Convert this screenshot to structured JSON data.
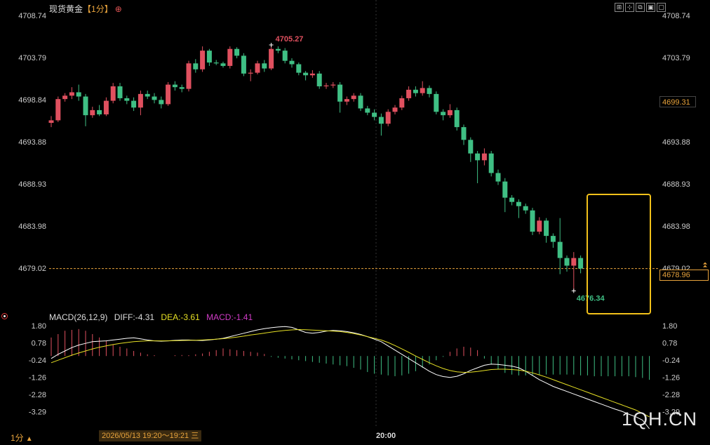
{
  "header": {
    "name": "现货黄金",
    "period_tag": "【1分】",
    "add_icon": "⊕"
  },
  "toolbar": {
    "icons": [
      "fullscreen-icon",
      "crosshair-icon",
      "settings-icon",
      "expand-icon",
      "minimize-icon"
    ],
    "glyphs": [
      "⊞",
      "⊹",
      "⧉",
      "▣",
      "▢"
    ]
  },
  "price_axis": {
    "ticks": [
      4708.74,
      4703.79,
      4698.84,
      4693.88,
      4688.93,
      4683.98,
      4679.02
    ],
    "tick_labels": [
      "4708.74",
      "4703.79",
      "4698.84",
      "4693.88",
      "4688.93",
      "4683.98",
      "4679.02"
    ],
    "current_marker": "4699.31",
    "last_price": "4678.96"
  },
  "macd_axis": {
    "ticks": [
      1.8,
      0.78,
      -0.24,
      -1.26,
      -2.28,
      -3.29
    ],
    "tick_labels": [
      "1.80",
      "0.78",
      "-0.24",
      "-1.26",
      "-2.28",
      "-3.29"
    ]
  },
  "macd_legend": {
    "params": "MACD(26,12,9)",
    "diff": "DIFF:-4.31",
    "dea": "DEA:-3.61",
    "macd": "MACD:-1.41"
  },
  "footer": {
    "period": "1分",
    "period_arrow": "▲",
    "range": "2026/05/13 19:20～19:21 三",
    "time_label": "20:00"
  },
  "watermark": "1QH.CN",
  "colors": {
    "up": "#e0505f",
    "down": "#3fbf84",
    "dea": "#e6e024",
    "diff": "#ffffff",
    "accent": "#e8a33c",
    "highlight_box": "#f2c11a"
  },
  "chart_data": [
    {
      "type": "candlestick",
      "title": "现货黄金【1分】",
      "ylim": [
        4676.0,
        4710.0
      ],
      "high_annotation": "4705.27",
      "low_annotation": "4676.34",
      "candles": [
        {
          "o": 4696.1,
          "c": 4696.4,
          "h": 4696.9,
          "l": 4695.6
        },
        {
          "o": 4696.4,
          "c": 4698.9,
          "h": 4699.2,
          "l": 4696.2
        },
        {
          "o": 4698.9,
          "c": 4699.3,
          "h": 4699.6,
          "l": 4698.6
        },
        {
          "o": 4699.3,
          "c": 4699.7,
          "h": 4700.3,
          "l": 4698.9
        },
        {
          "o": 4699.7,
          "c": 4699.2,
          "h": 4700.6,
          "l": 4698.7
        },
        {
          "o": 4699.2,
          "c": 4697.0,
          "h": 4699.5,
          "l": 4695.7
        },
        {
          "o": 4697.0,
          "c": 4697.6,
          "h": 4698.0,
          "l": 4696.7
        },
        {
          "o": 4697.6,
          "c": 4697.1,
          "h": 4698.2,
          "l": 4696.9
        },
        {
          "o": 4697.1,
          "c": 4698.7,
          "h": 4699.1,
          "l": 4696.9
        },
        {
          "o": 4698.7,
          "c": 4700.4,
          "h": 4700.8,
          "l": 4698.4
        },
        {
          "o": 4700.4,
          "c": 4699.0,
          "h": 4700.8,
          "l": 4698.7
        },
        {
          "o": 4699.0,
          "c": 4698.7,
          "h": 4699.3,
          "l": 4698.3
        },
        {
          "o": 4698.7,
          "c": 4697.9,
          "h": 4699.1,
          "l": 4697.5
        },
        {
          "o": 4697.9,
          "c": 4699.5,
          "h": 4699.9,
          "l": 4697.0
        },
        {
          "o": 4699.5,
          "c": 4699.2,
          "h": 4699.9,
          "l": 4698.9
        },
        {
          "o": 4699.2,
          "c": 4698.8,
          "h": 4699.6,
          "l": 4698.4
        },
        {
          "o": 4698.8,
          "c": 4698.3,
          "h": 4699.2,
          "l": 4697.8
        },
        {
          "o": 4698.3,
          "c": 4700.6,
          "h": 4700.9,
          "l": 4698.1
        },
        {
          "o": 4700.6,
          "c": 4700.3,
          "h": 4701.0,
          "l": 4699.9
        },
        {
          "o": 4700.3,
          "c": 4700.1,
          "h": 4700.6,
          "l": 4699.7
        },
        {
          "o": 4700.1,
          "c": 4703.1,
          "h": 4703.4,
          "l": 4699.8
        },
        {
          "o": 4703.1,
          "c": 4702.4,
          "h": 4703.6,
          "l": 4702.0
        },
        {
          "o": 4702.4,
          "c": 4704.6,
          "h": 4705.1,
          "l": 4702.1
        },
        {
          "o": 4704.6,
          "c": 4703.2,
          "h": 4704.8,
          "l": 4702.8
        },
        {
          "o": 4703.2,
          "c": 4703.1,
          "h": 4703.5,
          "l": 4702.9
        },
        {
          "o": 4703.1,
          "c": 4702.8,
          "h": 4703.3,
          "l": 4702.6
        },
        {
          "o": 4702.8,
          "c": 4704.8,
          "h": 4705.1,
          "l": 4702.5
        },
        {
          "o": 4704.8,
          "c": 4704.0,
          "h": 4705.0,
          "l": 4703.7
        },
        {
          "o": 4704.0,
          "c": 4701.9,
          "h": 4704.3,
          "l": 4701.6
        },
        {
          "o": 4701.9,
          "c": 4702.0,
          "h": 4702.4,
          "l": 4701.0
        },
        {
          "o": 4702.0,
          "c": 4703.1,
          "h": 4703.4,
          "l": 4701.8
        },
        {
          "o": 4703.1,
          "c": 4702.5,
          "h": 4703.5,
          "l": 4702.1
        },
        {
          "o": 4702.5,
          "c": 4704.8,
          "h": 4705.27,
          "l": 4702.3
        },
        {
          "o": 4704.8,
          "c": 4704.6,
          "h": 4705.1,
          "l": 4704.3
        },
        {
          "o": 4704.6,
          "c": 4703.4,
          "h": 4704.9,
          "l": 4703.1
        },
        {
          "o": 4703.4,
          "c": 4703.0,
          "h": 4703.7,
          "l": 4702.6
        },
        {
          "o": 4703.0,
          "c": 4702.0,
          "h": 4703.2,
          "l": 4701.7
        },
        {
          "o": 4702.0,
          "c": 4701.7,
          "h": 4702.2,
          "l": 4701.1
        },
        {
          "o": 4701.7,
          "c": 4701.9,
          "h": 4702.3,
          "l": 4701.4
        },
        {
          "o": 4701.9,
          "c": 4700.4,
          "h": 4702.2,
          "l": 4700.1
        },
        {
          "o": 4700.4,
          "c": 4700.5,
          "h": 4700.8,
          "l": 4700.1
        },
        {
          "o": 4700.5,
          "c": 4700.6,
          "h": 4700.9,
          "l": 4700.2
        },
        {
          "o": 4700.6,
          "c": 4698.6,
          "h": 4700.9,
          "l": 4697.3
        },
        {
          "o": 4698.6,
          "c": 4698.9,
          "h": 4699.2,
          "l": 4698.2
        },
        {
          "o": 4698.9,
          "c": 4699.3,
          "h": 4699.6,
          "l": 4698.6
        },
        {
          "o": 4699.3,
          "c": 4697.8,
          "h": 4699.6,
          "l": 4697.5
        },
        {
          "o": 4697.8,
          "c": 4697.3,
          "h": 4698.1,
          "l": 4697.0
        },
        {
          "o": 4697.3,
          "c": 4696.8,
          "h": 4697.7,
          "l": 4696.4
        },
        {
          "o": 4696.8,
          "c": 4696.0,
          "h": 4697.2,
          "l": 4694.6
        },
        {
          "o": 4696.0,
          "c": 4697.4,
          "h": 4697.7,
          "l": 4695.7
        },
        {
          "o": 4697.4,
          "c": 4697.9,
          "h": 4698.2,
          "l": 4697.1
        },
        {
          "o": 4697.9,
          "c": 4699.0,
          "h": 4699.3,
          "l": 4697.6
        },
        {
          "o": 4699.0,
          "c": 4700.0,
          "h": 4700.4,
          "l": 4698.7
        },
        {
          "o": 4700.0,
          "c": 4699.6,
          "h": 4700.4,
          "l": 4699.2
        },
        {
          "o": 4699.6,
          "c": 4700.2,
          "h": 4701.0,
          "l": 4699.3
        },
        {
          "o": 4700.2,
          "c": 4699.5,
          "h": 4700.5,
          "l": 4699.1
        },
        {
          "o": 4699.5,
          "c": 4697.4,
          "h": 4699.8,
          "l": 4697.1
        },
        {
          "o": 4697.4,
          "c": 4697.0,
          "h": 4697.7,
          "l": 4696.4
        },
        {
          "o": 4697.0,
          "c": 4697.6,
          "h": 4698.3,
          "l": 4696.7
        },
        {
          "o": 4697.6,
          "c": 4695.6,
          "h": 4697.9,
          "l": 4695.2
        },
        {
          "o": 4695.6,
          "c": 4694.1,
          "h": 4695.9,
          "l": 4693.5
        },
        {
          "o": 4694.1,
          "c": 4692.5,
          "h": 4694.4,
          "l": 4691.5
        },
        {
          "o": 4692.5,
          "c": 4691.7,
          "h": 4692.8,
          "l": 4689.0
        },
        {
          "o": 4691.7,
          "c": 4692.5,
          "h": 4693.1,
          "l": 4691.1
        },
        {
          "o": 4692.5,
          "c": 4690.2,
          "h": 4692.8,
          "l": 4689.8
        },
        {
          "o": 4690.2,
          "c": 4689.2,
          "h": 4690.6,
          "l": 4688.8
        },
        {
          "o": 4689.2,
          "c": 4687.3,
          "h": 4689.6,
          "l": 4685.6
        },
        {
          "o": 4687.3,
          "c": 4686.8,
          "h": 4687.6,
          "l": 4686.4
        },
        {
          "o": 4686.8,
          "c": 4686.3,
          "h": 4687.1,
          "l": 4684.9
        },
        {
          "o": 4686.3,
          "c": 4685.8,
          "h": 4686.6,
          "l": 4685.4
        },
        {
          "o": 4685.8,
          "c": 4683.3,
          "h": 4686.1,
          "l": 4682.9
        },
        {
          "o": 4683.3,
          "c": 4684.6,
          "h": 4685.0,
          "l": 4683.0
        },
        {
          "o": 4684.6,
          "c": 4682.8,
          "h": 4684.9,
          "l": 4682.0
        },
        {
          "o": 4682.8,
          "c": 4682.1,
          "h": 4683.1,
          "l": 4681.4
        },
        {
          "o": 4682.1,
          "c": 4680.2,
          "h": 4684.9,
          "l": 4678.3
        },
        {
          "o": 4680.2,
          "c": 4679.3,
          "h": 4680.5,
          "l": 4678.6
        },
        {
          "o": 4679.3,
          "c": 4680.2,
          "h": 4680.9,
          "l": 4676.34
        },
        {
          "o": 4680.2,
          "c": 4678.96,
          "h": 4680.5,
          "l": 4678.4
        }
      ]
    },
    {
      "type": "macd",
      "params": "MACD(26,12,9)",
      "ylim": [
        -3.75,
        2.0
      ],
      "series": [
        {
          "name": "DIFF",
          "values": [
            -0.15,
            0.1,
            0.3,
            0.5,
            0.65,
            0.75,
            0.85,
            0.88,
            0.9,
            0.95,
            1.0,
            1.05,
            1.08,
            1.02,
            0.95,
            0.9,
            0.88,
            0.9,
            0.93,
            0.95,
            0.95,
            0.93,
            0.92,
            0.95,
            1.0,
            1.05,
            1.15,
            1.25,
            1.35,
            1.45,
            1.55,
            1.62,
            1.68,
            1.72,
            1.75,
            1.7,
            1.55,
            1.4,
            1.35,
            1.4,
            1.48,
            1.52,
            1.5,
            1.45,
            1.38,
            1.28,
            1.15,
            1.0,
            0.85,
            0.6,
            0.35,
            0.1,
            -0.15,
            -0.4,
            -0.65,
            -0.9,
            -1.1,
            -1.22,
            -1.27,
            -1.2,
            -1.05,
            -0.85,
            -0.7,
            -0.55,
            -0.48,
            -0.5,
            -0.55,
            -0.6,
            -0.7,
            -0.9,
            -1.15,
            -1.4,
            -1.6,
            -1.8,
            -1.95,
            -2.1,
            -2.25,
            -2.4,
            -2.55,
            -2.7,
            -2.85,
            -3.0,
            -3.15,
            -3.28,
            -3.45,
            -3.6,
            -3.8,
            -4.31
          ]
        },
        {
          "name": "DEA",
          "values": [
            -0.4,
            -0.25,
            -0.1,
            0.05,
            0.18,
            0.3,
            0.42,
            0.52,
            0.6,
            0.68,
            0.75,
            0.8,
            0.85,
            0.88,
            0.9,
            0.9,
            0.9,
            0.9,
            0.91,
            0.92,
            0.93,
            0.94,
            0.95,
            0.97,
            1.0,
            1.03,
            1.07,
            1.12,
            1.18,
            1.25,
            1.3,
            1.36,
            1.42,
            1.47,
            1.52,
            1.55,
            1.57,
            1.56,
            1.54,
            1.52,
            1.5,
            1.48,
            1.45,
            1.4,
            1.33,
            1.25,
            1.15,
            1.05,
            0.95,
            0.8,
            0.62,
            0.42,
            0.22,
            0.0,
            -0.2,
            -0.4,
            -0.58,
            -0.74,
            -0.86,
            -0.94,
            -0.97,
            -0.96,
            -0.92,
            -0.86,
            -0.8,
            -0.78,
            -0.78,
            -0.8,
            -0.83,
            -0.9,
            -1.0,
            -1.12,
            -1.25,
            -1.4,
            -1.55,
            -1.7,
            -1.85,
            -2.0,
            -2.15,
            -2.3,
            -2.45,
            -2.6,
            -2.75,
            -2.9,
            -3.05,
            -3.2,
            -3.4,
            -3.61
          ]
        }
      ],
      "histogram": [
        1.1,
        1.3,
        1.5,
        1.55,
        1.6,
        1.5,
        1.3,
        1.1,
        0.9,
        0.7,
        0.55,
        0.45,
        0.3,
        0.2,
        0.1,
        0.05,
        0.0,
        0.0,
        0.05,
        0.06,
        0.05,
        0.1,
        0.15,
        0.25,
        0.35,
        0.45,
        0.4,
        0.35,
        0.3,
        0.25,
        0.2,
        0.12,
        -0.05,
        -0.1,
        -0.15,
        -0.2,
        -0.25,
        -0.3,
        -0.35,
        -0.4,
        -0.45,
        -0.5,
        -0.55,
        -0.6,
        -0.7,
        -0.8,
        -0.95,
        -1.05,
        -1.1,
        -1.15,
        -1.2,
        -1.15,
        -1.05,
        -0.9,
        -0.7,
        -0.5,
        -0.25,
        -0.05,
        0.25,
        0.45,
        0.55,
        0.5,
        0.35,
        -0.15,
        -0.5,
        -0.8,
        -1.0,
        -1.1,
        -1.15,
        -1.15,
        -1.15,
        -1.1,
        -1.1,
        -1.1,
        -1.1,
        -1.1,
        -1.1,
        -1.15,
        -1.15,
        -1.2,
        -1.2,
        -1.2,
        -1.2,
        -1.2,
        -1.2,
        -1.25,
        -1.3,
        -1.41
      ]
    }
  ]
}
